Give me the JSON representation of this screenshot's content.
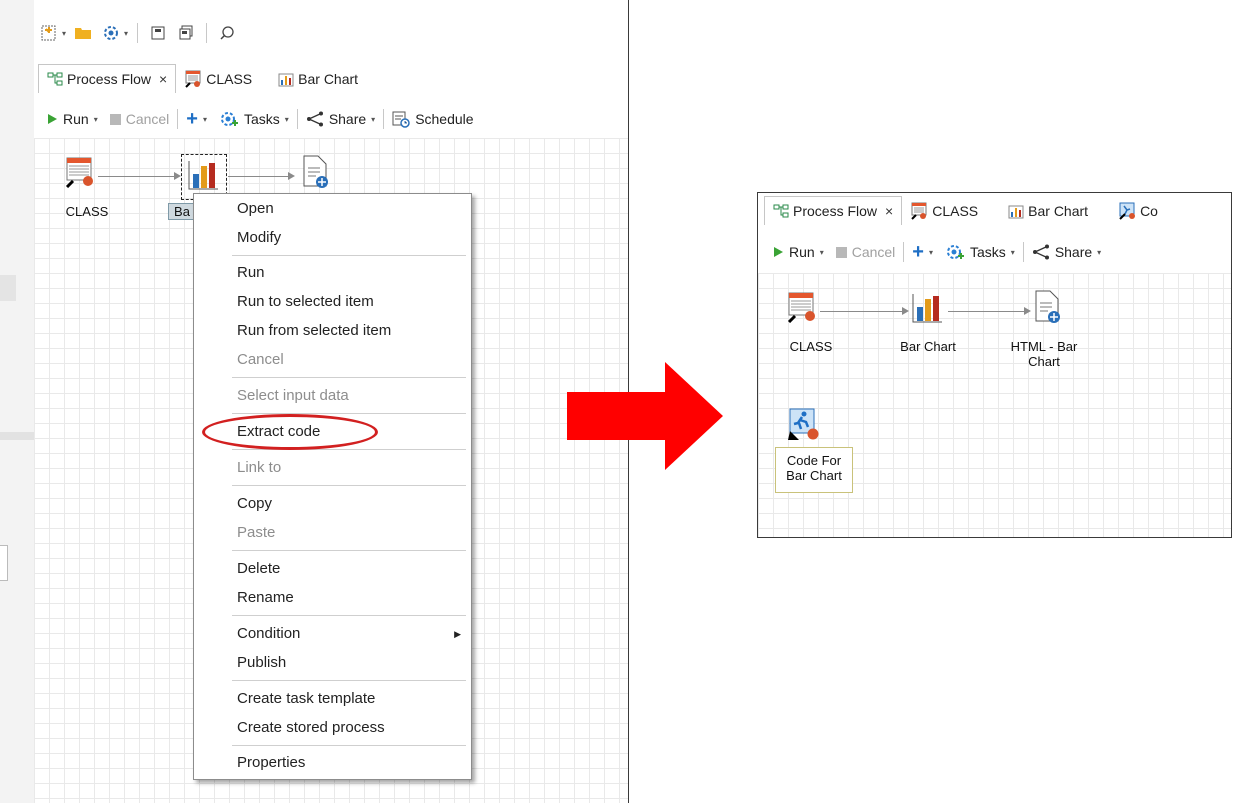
{
  "left": {
    "tabs": [
      {
        "label": "Process Flow",
        "close": "×",
        "icon": "process-flow-icon"
      },
      {
        "label": "CLASS",
        "icon": "dataset-icon"
      },
      {
        "label": "Bar Chart",
        "icon": "bar-chart-icon"
      }
    ],
    "actions": {
      "run": "Run",
      "cancel": "Cancel",
      "add": "+",
      "tasks": "Tasks",
      "share": "Share",
      "schedule": "Schedule"
    },
    "nodes": {
      "class_label": "CLASS",
      "bar_label_partial": "Ba"
    }
  },
  "context_menu": {
    "items": [
      {
        "label": "Open",
        "enabled": true
      },
      {
        "label": "Modify",
        "enabled": true
      },
      {
        "label": "Run",
        "enabled": true
      },
      {
        "label": "Run to selected item",
        "enabled": true
      },
      {
        "label": "Run from selected item",
        "enabled": true
      },
      {
        "label": "Cancel",
        "enabled": false
      },
      {
        "label": "Select input data",
        "enabled": false
      },
      {
        "label": "Extract code",
        "enabled": true,
        "highlighted": true
      },
      {
        "label": "Link to",
        "enabled": false
      },
      {
        "label": "Copy",
        "enabled": true
      },
      {
        "label": "Paste",
        "enabled": false
      },
      {
        "label": "Delete",
        "enabled": true
      },
      {
        "label": "Rename",
        "enabled": true
      },
      {
        "label": "Condition",
        "enabled": true,
        "submenu": true
      },
      {
        "label": "Publish",
        "enabled": true
      },
      {
        "label": "Create task template",
        "enabled": true
      },
      {
        "label": "Create stored process",
        "enabled": true
      },
      {
        "label": "Properties",
        "enabled": true
      }
    ]
  },
  "right": {
    "tabs": [
      {
        "label": "Process Flow",
        "close": "×",
        "icon": "process-flow-icon"
      },
      {
        "label": "CLASS",
        "icon": "dataset-icon"
      },
      {
        "label": "Bar Chart",
        "icon": "bar-chart-icon"
      },
      {
        "label": "Co",
        "icon": "code-icon"
      }
    ],
    "actions": {
      "run": "Run",
      "cancel": "Cancel",
      "add": "+",
      "tasks": "Tasks",
      "share": "Share"
    },
    "nodes": {
      "class_label": "CLASS",
      "bar_label": "Bar Chart",
      "html_label_line1": "HTML - Bar",
      "html_label_line2": "Chart",
      "code_label_line1": "Code For",
      "code_label_line2": "Bar Chart"
    }
  },
  "colors": {
    "arrow": "#ff0000",
    "highlight_ellipse": "#d22020",
    "run_green": "#3aa335",
    "accent_blue": "#1f6fc5"
  }
}
